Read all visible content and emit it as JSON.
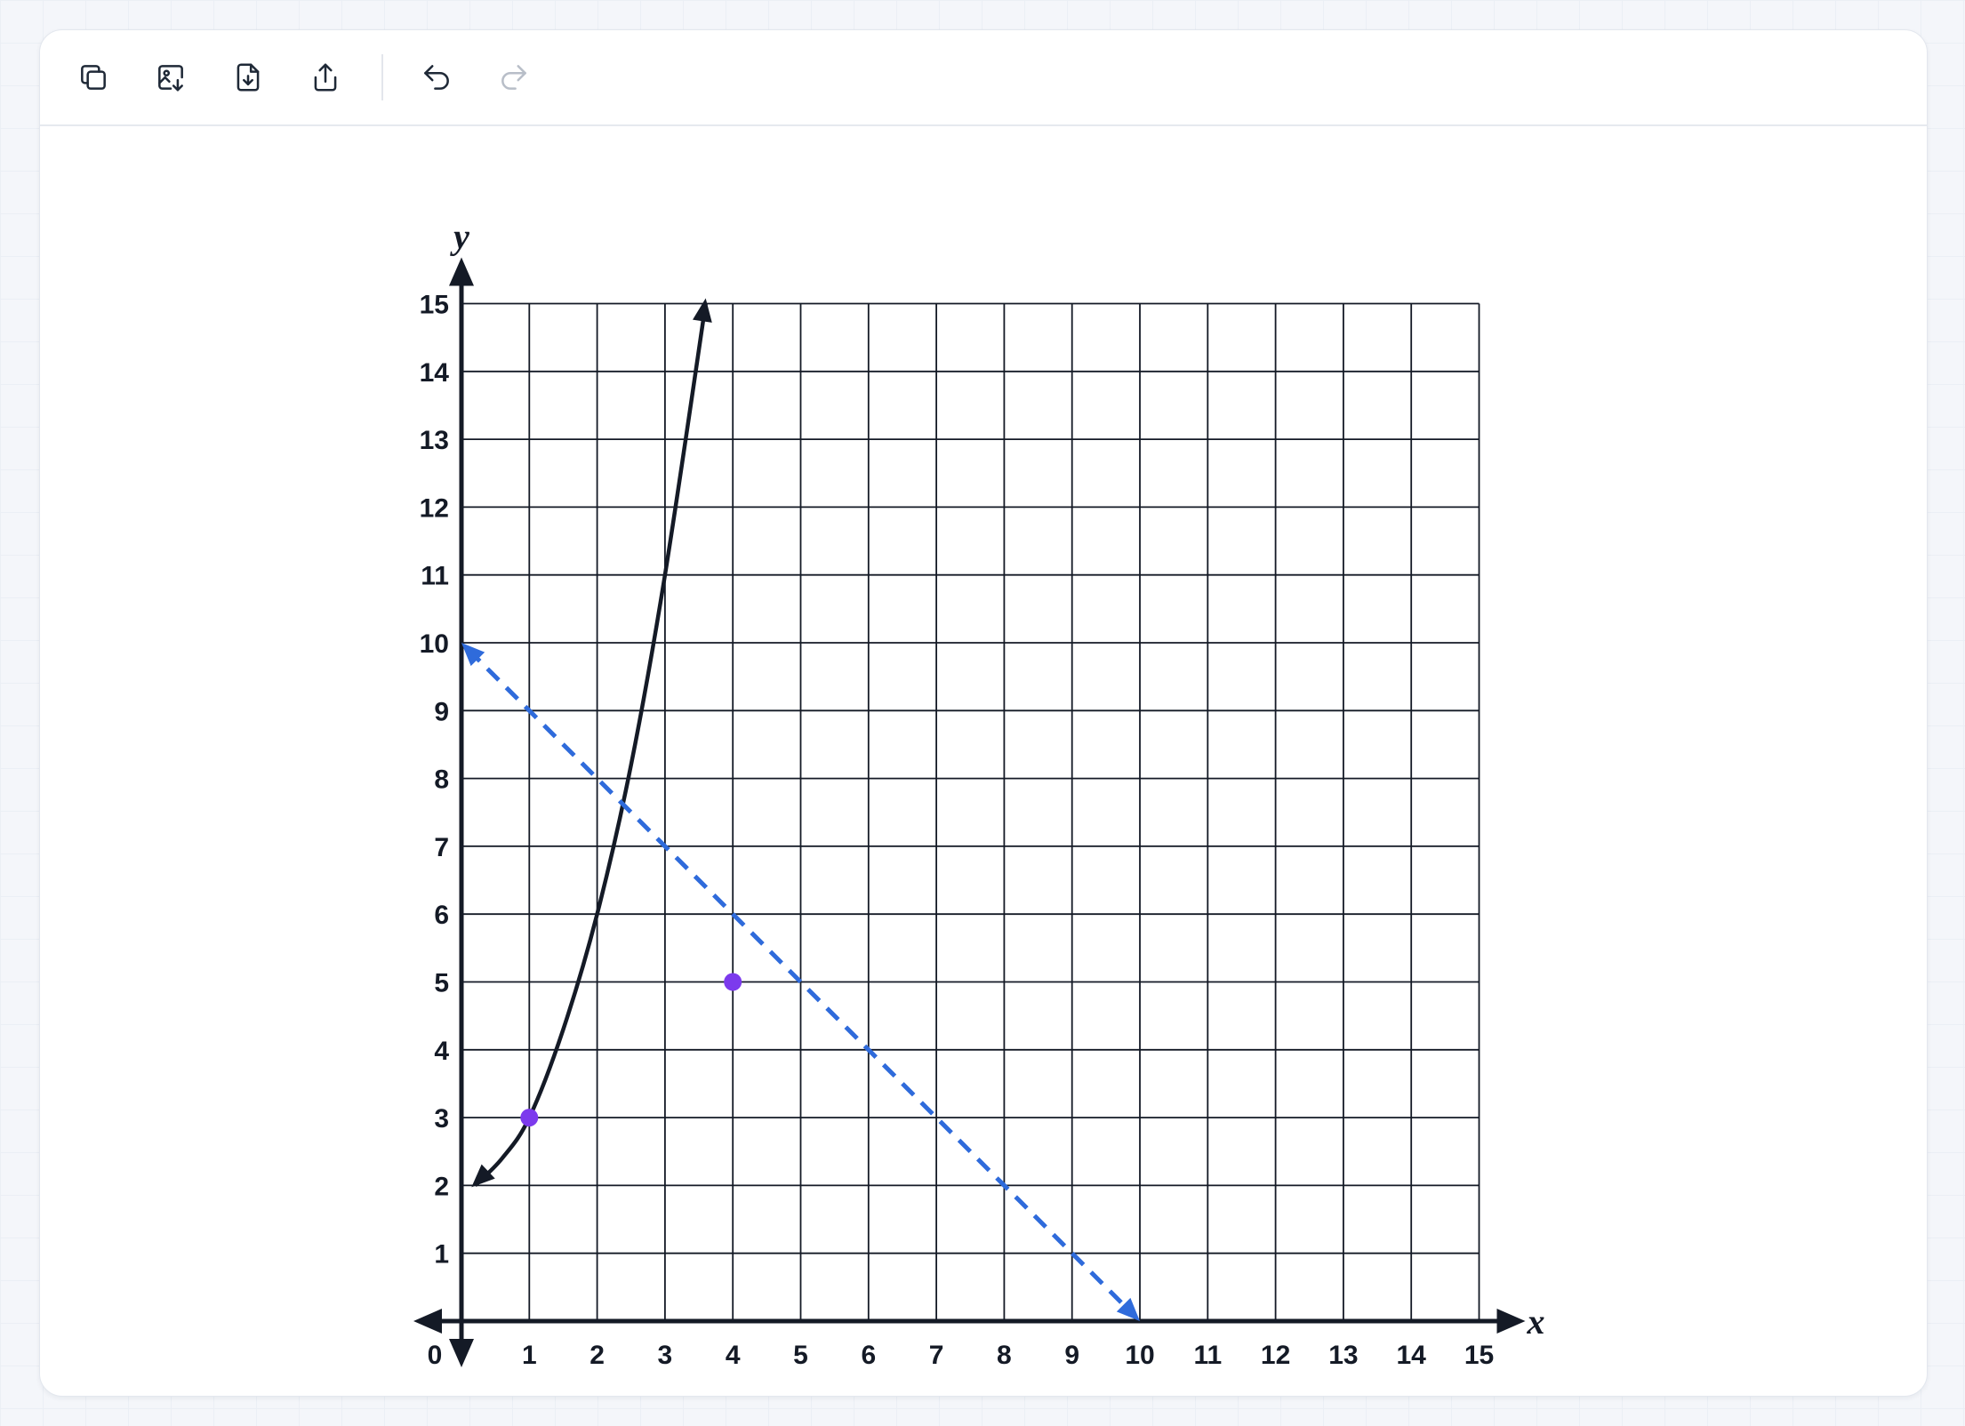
{
  "toolbar": {
    "buttons": [
      {
        "id": "copy",
        "icon": "copy-icon"
      },
      {
        "id": "save-image",
        "icon": "image-download-icon"
      },
      {
        "id": "download-file",
        "icon": "file-download-icon"
      },
      {
        "id": "share",
        "icon": "share-icon"
      },
      {
        "id": "undo",
        "icon": "undo-icon"
      },
      {
        "id": "redo",
        "icon": "redo-icon",
        "disabled": true
      }
    ]
  },
  "chart_data": {
    "type": "scatter",
    "xlabel": "x",
    "ylabel": "y",
    "xlim": [
      0,
      15
    ],
    "ylim": [
      0,
      15
    ],
    "x_ticks": [
      "0",
      "1",
      "2",
      "3",
      "4",
      "5",
      "6",
      "7",
      "8",
      "9",
      "10",
      "11",
      "12",
      "13",
      "14",
      "15"
    ],
    "y_ticks": [
      "1",
      "2",
      "3",
      "4",
      "5",
      "6",
      "7",
      "8",
      "9",
      "10",
      "11",
      "12",
      "13",
      "14",
      "15"
    ],
    "grid": true,
    "curve": {
      "points": [
        [
          0.2,
          2.0
        ],
        [
          0.6,
          2.4
        ],
        [
          1.0,
          3.0
        ],
        [
          1.5,
          4.3
        ],
        [
          2.0,
          6.0
        ],
        [
          2.5,
          8.2
        ],
        [
          3.0,
          11.0
        ],
        [
          3.6,
          15.0
        ]
      ],
      "color": "#141a26",
      "style": "solid",
      "arrows": "both"
    },
    "line": {
      "points": [
        [
          0,
          10
        ],
        [
          10,
          0
        ]
      ],
      "color": "#2f6bdb",
      "style": "dashed",
      "arrows": "both"
    },
    "points": [
      {
        "x": 1,
        "y": 3,
        "color": "#7c3aed"
      },
      {
        "x": 4,
        "y": 5,
        "color": "#7c3aed"
      }
    ]
  }
}
